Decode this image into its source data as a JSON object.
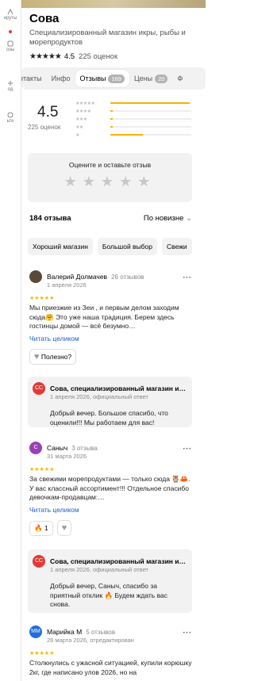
{
  "sidebar": {
    "items": [
      {
        "label": "ируты",
        "icon": "route-icon"
      },
      {
        "label": "озы",
        "icon": "bus-icon"
      },
      {
        "label": "од",
        "icon": "food-icon"
      },
      {
        "label": "ьте",
        "icon": "more-icon"
      }
    ]
  },
  "place": {
    "title": "Сова",
    "subtitle": "Специализированный магазин икры, рыбы и морепродуктов",
    "rating": "4.5",
    "rating_count": "225 оценок"
  },
  "tabs": [
    {
      "label": "нтакты"
    },
    {
      "label": "Инфо"
    },
    {
      "label": "Отзывы",
      "badge": "169",
      "active": true
    },
    {
      "label": "Цены",
      "badge": "20"
    },
    {
      "label": "Ф"
    }
  ],
  "summary": {
    "score": "4.5",
    "score_sub": "225 оценок",
    "distribution": [
      {
        "stars": 5,
        "fraction": 0.98
      },
      {
        "stars": 4,
        "fraction": 0.03
      },
      {
        "stars": 3,
        "fraction": 0.03
      },
      {
        "stars": 2,
        "fraction": 0.03
      },
      {
        "stars": 1,
        "fraction": 0.4
      }
    ]
  },
  "rate_prompt": "Оцените и оставьте отзыв",
  "reviews_header": {
    "count": "184 отзыва",
    "sort": "По новизне"
  },
  "chips": [
    "Хороший магазин",
    "Большой выбор",
    "Свежи"
  ],
  "reviews": [
    {
      "author": "Валерий Долмачев",
      "author_reviews": "26 отзывов",
      "date": "1 апреля 2026",
      "avatar_color": "#5a4a3a",
      "avatar_initials": "",
      "stars": "★★★★★",
      "text": "Мы приезжие из Зеи , и первым делом заходим сюда🤗 Это уже наша традиция. Берем здесь гостинцы домой — всё безумно…",
      "read_more": "Читать целиком",
      "helpful": "Полезно?",
      "reply": {
        "author": "Сова, специализированный магазин и…",
        "meta": "1 апреля 2026, официальный ответ",
        "text": "Добрый вечер. Большое спасибо, что оценили!!! Мы работаем для вас!",
        "initials": "СС"
      }
    },
    {
      "author": "Саныч",
      "author_reviews": "3 отзыва",
      "date": "31 марта 2026",
      "avatar_color": "#9c3fb5",
      "avatar_initials": "С",
      "stars": "★★★★★",
      "text": "За свежими морепродуктами — только сюда 🦉🦀. У вас классный ассортимент!!! Отдельное спасибо девочкам-продавцам:…",
      "read_more": "Читать целиком",
      "likes": "1",
      "reply": {
        "author": "Сова, специализированный магазин и…",
        "meta": "1 апреля 2026, официальный ответ",
        "text": "Добрый вечер, Саныч, спасибо за приятный отклик 🔥 Будем ждать вас снова.",
        "initials": "СС"
      }
    },
    {
      "author": "Марийка М",
      "author_reviews": "5 отзывов",
      "date": "26 марта 2026, отредактирован",
      "avatar_color": "#1e6fd9",
      "avatar_initials": "ММ",
      "stars": "★★★★★",
      "text": "Столкнулись с ужасной ситуацией, купили корюшку 2кг, где написано улов 2026, но на"
    }
  ]
}
